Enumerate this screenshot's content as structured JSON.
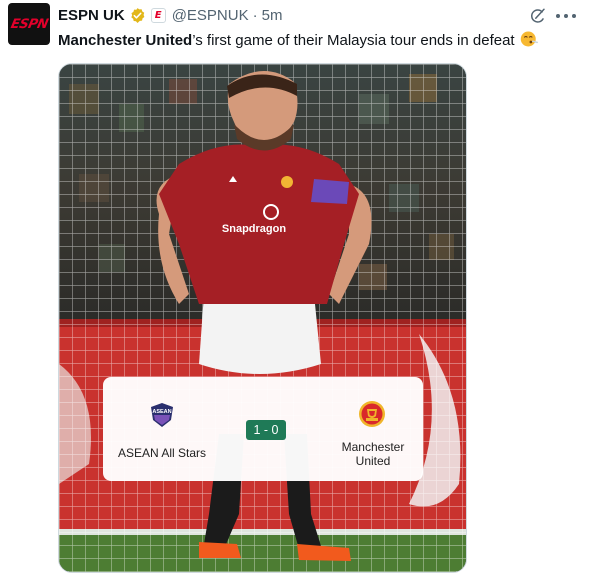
{
  "tweet": {
    "avatar_text": "ESPN",
    "display_name": "ESPN UK",
    "affiliate_badge": "E",
    "handle": "@ESPNUK",
    "separator": "·",
    "time": "5m",
    "text_bold": "Manchester United",
    "text_rest": "’s first game of their Malaysia tour ends in defeat",
    "emoji": "😮‍💨"
  },
  "match": {
    "home_team": "ASEAN All Stars",
    "home_logo_text": "ASEAN",
    "score": "1 - 0",
    "away_team_line1": "Manchester",
    "away_team_line2": "United"
  },
  "colors": {
    "brand": "#e4002b",
    "verified": "#e2b719",
    "score_badge": "#1f7a57",
    "united_red": "#b3202a"
  },
  "icons": [
    "verified-badge-icon",
    "grok-icon",
    "more-icon"
  ]
}
